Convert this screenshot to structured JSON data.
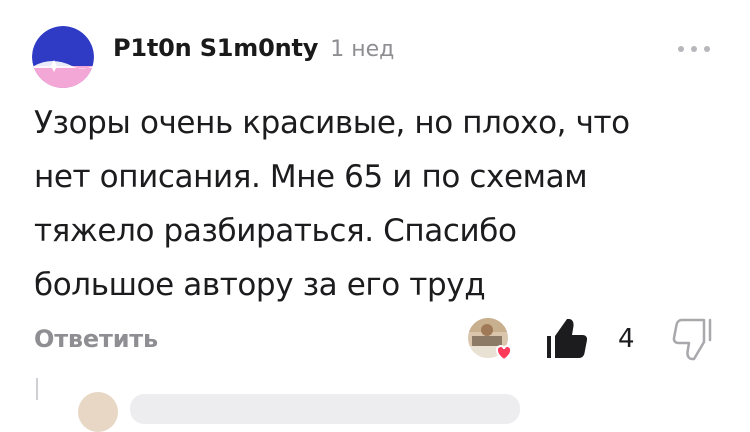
{
  "comment": {
    "author": "P1t0n S1m0nty",
    "time": "1 нед",
    "text": "Узоры очень красивые, но плохо, что\nнет описания. Мне 65 и по схемам\nтяжело разбираться. Спасибо\nбольшое автору за его труд",
    "reply_label": "Ответить",
    "like_count": "4"
  },
  "icons": {
    "more": "more-dots-icon",
    "like": "thumbs-up-icon",
    "dislike": "thumbs-down-icon",
    "reaction": "heart-icon"
  },
  "colors": {
    "avatar_blue": "#2f3bc4",
    "avatar_pink": "#f2a7d6",
    "heart": "#ff3b5c",
    "muted": "#8e8e93"
  }
}
